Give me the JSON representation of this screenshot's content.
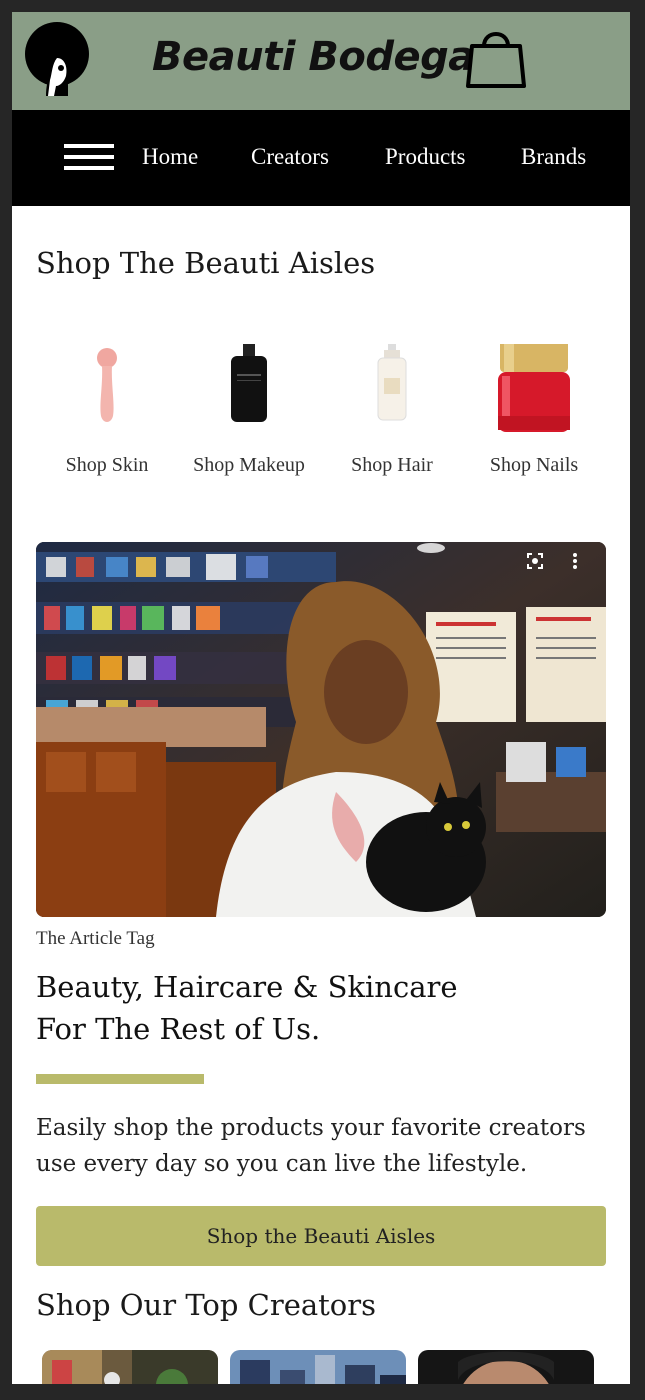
{
  "header": {
    "brand_name": "Beauti Bodega",
    "logo_icon": "afro-silhouette-logo",
    "cart_icon": "shopping-bag-icon",
    "colors": {
      "brand_bar": "#8a9e87",
      "nav_bar": "#000000",
      "accent": "#b9ba6b"
    }
  },
  "nav": {
    "menu_icon": "hamburger-menu-icon",
    "items": [
      "Home",
      "Creators",
      "Products",
      "Brands"
    ]
  },
  "aisles": {
    "title": "Shop The Beauti Aisles",
    "items": [
      {
        "label": "Shop Skin",
        "icon": "facial-cleansing-brush"
      },
      {
        "label": "Shop Makeup",
        "icon": "black-serum-bottle"
      },
      {
        "label": "Shop Hair",
        "icon": "pump-lotion-bottle"
      },
      {
        "label": "Shop Nails",
        "icon": "red-nail-polish"
      }
    ]
  },
  "feature": {
    "image_overlay_icons": [
      "lens-icon",
      "more-vertical-icon"
    ],
    "article_tag": "The Article Tag",
    "headline_line1": "Beauty, Haircare & Skincare",
    "headline_line2": "For The Rest of Us.",
    "description": "Easily shop the products your favorite creators use every day so you can live the lifestyle.",
    "cta_label": "Shop the Beauti Aisles"
  },
  "creators": {
    "title": "Shop Our Top Creators",
    "count_visible": 3
  }
}
